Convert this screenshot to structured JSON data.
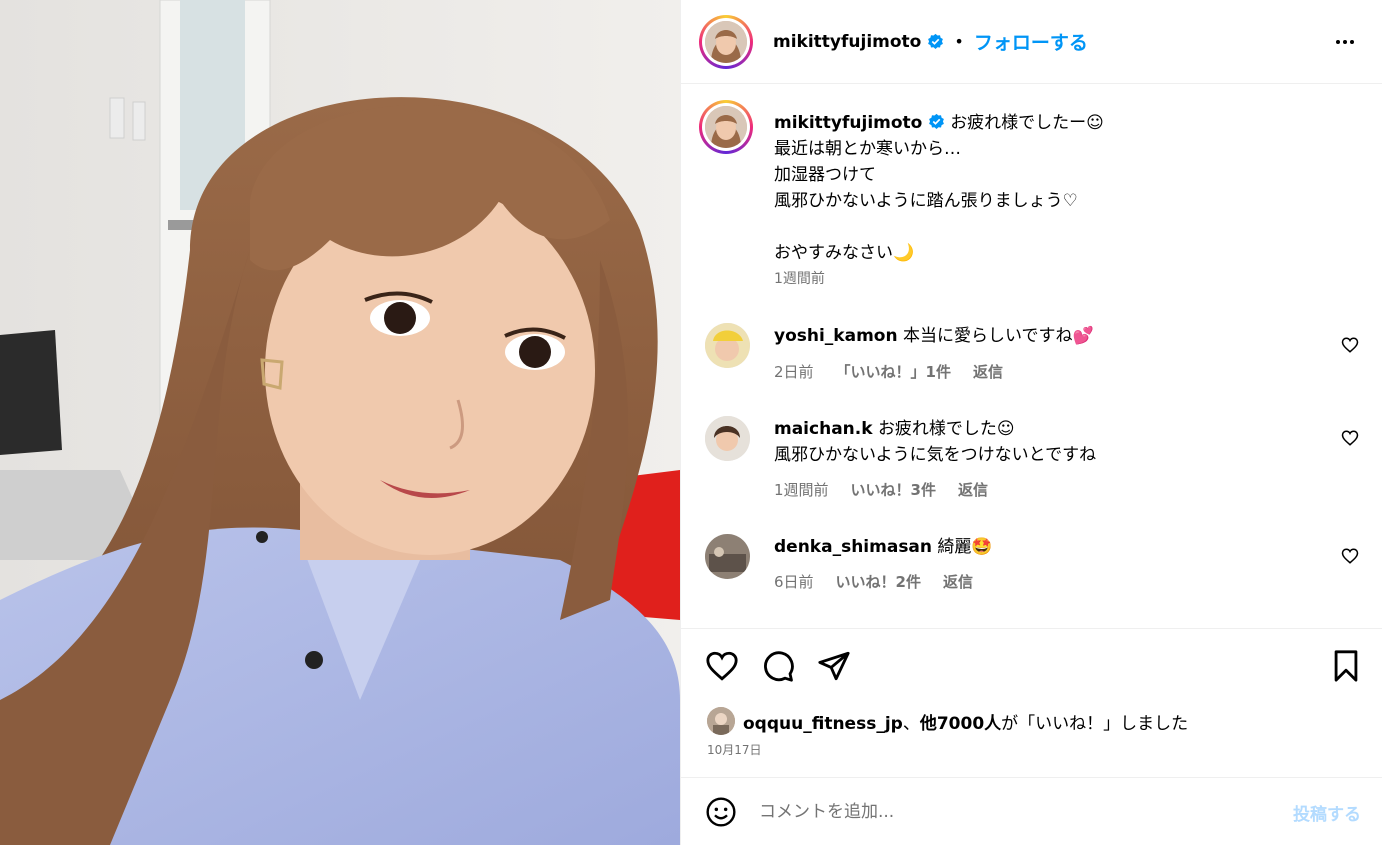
{
  "post": {
    "username": "mikittyfujimoto",
    "follow_label": "フォローする",
    "separator": "•",
    "more_icon": "more-horizontal-icon"
  },
  "caption": {
    "username": "mikittyfujimoto",
    "lines": [
      "お疲れ様でしたー☺",
      "最近は朝とか寒いから…",
      "加湿器つけて",
      "風邪ひかないように踏ん張りましょう♡",
      "",
      "おやすみなさい🌙"
    ],
    "time": "1週間前"
  },
  "comments": [
    {
      "username": "yoshi_kamon",
      "text": "本当に愛らしいですね💕",
      "text2": "",
      "time": "2日前",
      "likes": "「いいね！」1件",
      "reply": "返信"
    },
    {
      "username": "maichan.k",
      "text": "お疲れ様でした☺",
      "text2": "風邪ひかないように気をつけないとですね",
      "time": "1週間前",
      "likes": "いいね！3件",
      "reply": "返信"
    },
    {
      "username": "denka_shimasan",
      "text": "綺麗🤩",
      "text2": "",
      "time": "6日前",
      "likes": "いいね！2件",
      "reply": "返信"
    }
  ],
  "likes": {
    "user": "oqquu_fitness_jp",
    "sep": "、",
    "others": "他7000人",
    "suffix": "が「いいね！」しました"
  },
  "date": "10月17日",
  "composer": {
    "placeholder": "コメントを追加...",
    "post_label": "投稿する"
  },
  "colors": {
    "accent": "#0095f6",
    "muted": "#737373",
    "post_disabled": "#b3dbff"
  }
}
